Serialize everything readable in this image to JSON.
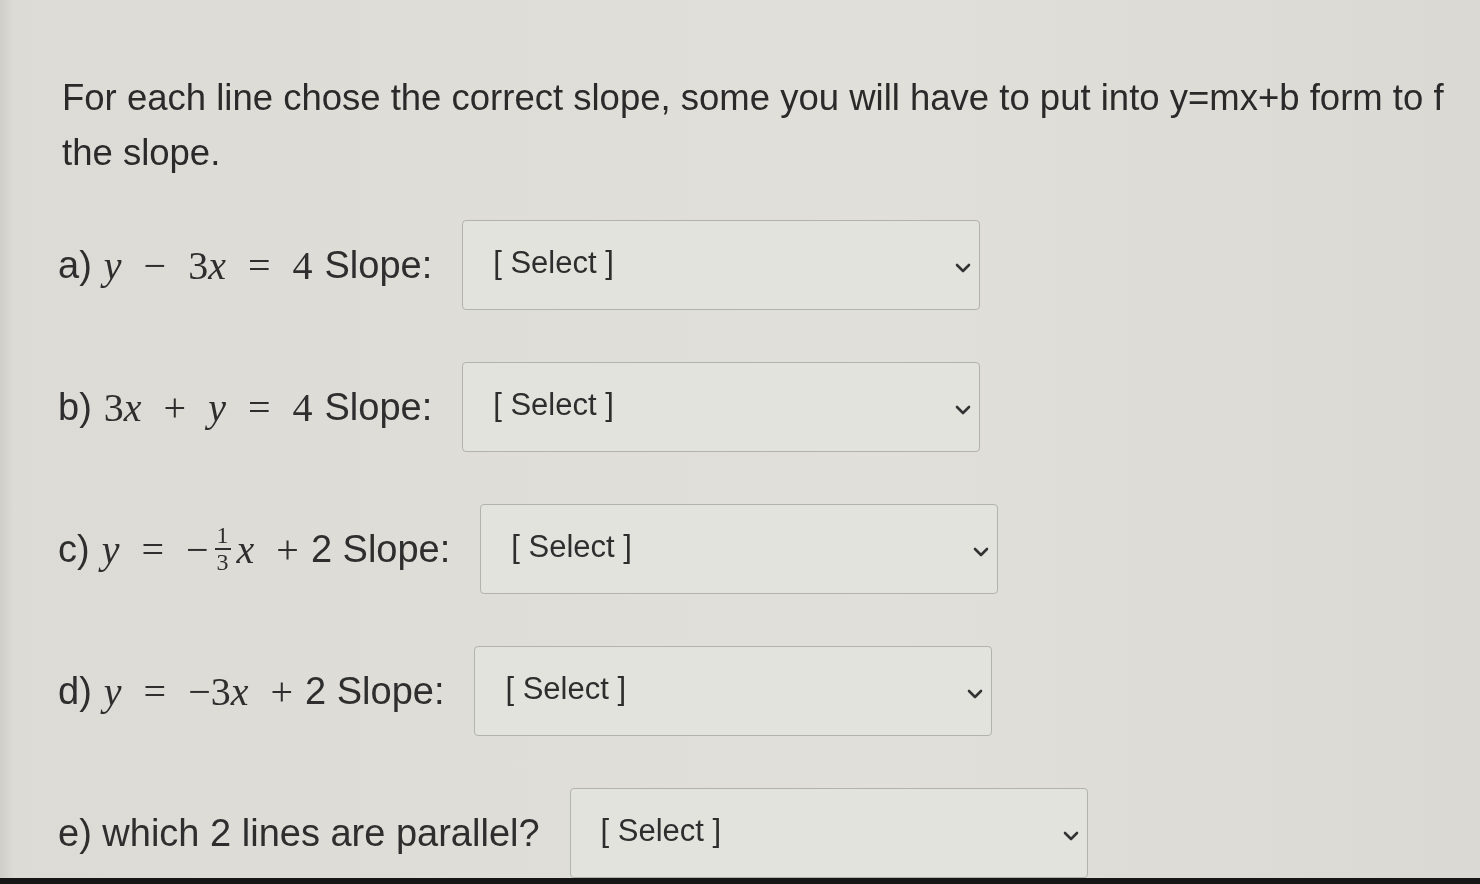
{
  "instructions": {
    "lines": [
      "For each line chose the correct slope, some you will have to put into y=mx+b form to f",
      "the slope."
    ]
  },
  "questions": [
    {
      "parts": [
        {
          "kind": "text",
          "text": "a)"
        },
        {
          "kind": "math",
          "tokens": [
            {
              "kind": "var",
              "text": "y"
            },
            {
              "kind": "op",
              "text": "−"
            },
            {
              "kind": "num",
              "text": "3"
            },
            {
              "kind": "var",
              "text": "x"
            },
            {
              "kind": "op",
              "text": "="
            },
            {
              "kind": "num",
              "text": "4"
            }
          ]
        },
        {
          "kind": "text",
          "text": "Slope:"
        }
      ],
      "dropdown": {
        "value": "[ Select ]"
      }
    },
    {
      "parts": [
        {
          "kind": "text",
          "text": "b)"
        },
        {
          "kind": "math",
          "tokens": [
            {
              "kind": "num",
              "text": "3"
            },
            {
              "kind": "var",
              "text": "x"
            },
            {
              "kind": "op",
              "text": "+"
            },
            {
              "kind": "var",
              "text": "y"
            },
            {
              "kind": "op",
              "text": "="
            },
            {
              "kind": "num",
              "text": "4"
            }
          ]
        },
        {
          "kind": "text",
          "text": "Slope:"
        }
      ],
      "dropdown": {
        "value": "[ Select ]"
      }
    },
    {
      "parts": [
        {
          "kind": "text",
          "text": "c)"
        },
        {
          "kind": "math",
          "tokens": [
            {
              "kind": "var",
              "text": "y"
            },
            {
              "kind": "op",
              "text": "="
            },
            {
              "kind": "num",
              "text": "−"
            }
          ]
        },
        {
          "kind": "fraction",
          "numerator": "1",
          "denominator": "3"
        },
        {
          "kind": "math",
          "tokens": [
            {
              "kind": "var",
              "text": "x"
            },
            {
              "kind": "op",
              "text": "+"
            }
          ]
        },
        {
          "kind": "text",
          "text": "2 Slope:"
        }
      ],
      "dropdown": {
        "value": "[ Select ]"
      }
    },
    {
      "parts": [
        {
          "kind": "text",
          "text": "d)"
        },
        {
          "kind": "math",
          "tokens": [
            {
              "kind": "var",
              "text": "y"
            },
            {
              "kind": "op",
              "text": "="
            },
            {
              "kind": "num",
              "text": "−3"
            },
            {
              "kind": "var",
              "text": "x"
            },
            {
              "kind": "op",
              "text": "+"
            }
          ]
        },
        {
          "kind": "text",
          "text": "2 Slope:"
        }
      ],
      "dropdown": {
        "value": "[ Select ]"
      }
    },
    {
      "parts": [
        {
          "kind": "text",
          "text": "e) which 2 lines are parallel?"
        }
      ],
      "dropdown": {
        "value": "[ Select ]"
      }
    }
  ]
}
